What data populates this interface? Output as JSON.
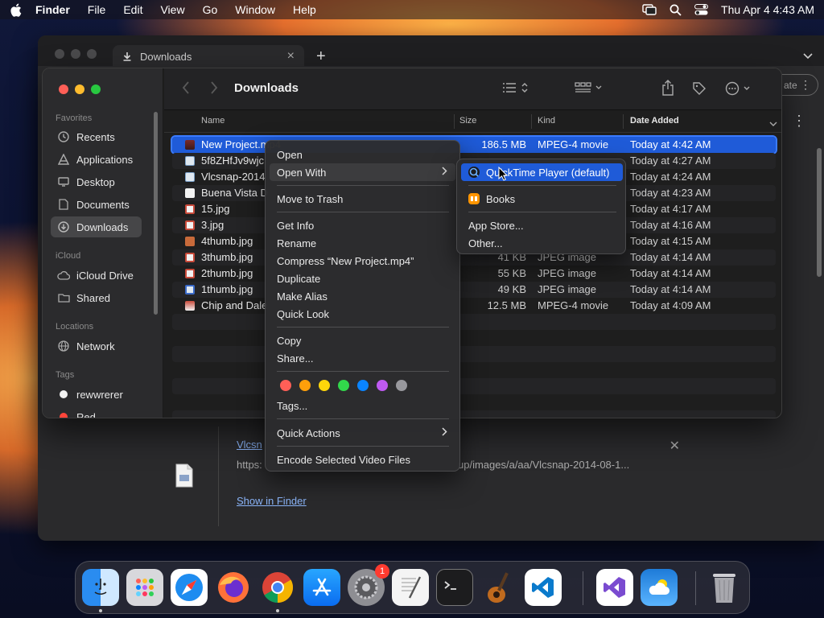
{
  "menubar": {
    "app_name": "Finder",
    "menus": [
      "File",
      "Edit",
      "View",
      "Go",
      "Window",
      "Help"
    ],
    "clock": "Thu Apr 4  4:43 AM"
  },
  "browser": {
    "tab_title": "Downloads",
    "side_pill_label": "ate",
    "download": {
      "file_link": "Vlcsn",
      "url_start": "https:",
      "url_end": "up/images/a/aa/Vlcsnap-2014-08-1...",
      "show_in_finder": "Show in Finder"
    }
  },
  "finder": {
    "title": "Downloads",
    "sidebar": {
      "favorites_label": "Favorites",
      "favorites": [
        "Recents",
        "Applications",
        "Desktop",
        "Documents",
        "Downloads"
      ],
      "icloud_label": "iCloud",
      "icloud": [
        "iCloud Drive",
        "Shared"
      ],
      "locations_label": "Locations",
      "locations": [
        "Network"
      ],
      "tags_label": "Tags",
      "tags": [
        "rewwrerer",
        "Red"
      ]
    },
    "columns": {
      "name": "Name",
      "size": "Size",
      "kind": "Kind",
      "date": "Date Added"
    },
    "files": [
      {
        "name": "New Project.mp4",
        "size": "186.5 MB",
        "kind": "MPEG-4 movie",
        "date": "Today at 4:42 AM"
      },
      {
        "name": "5f8ZHfJv9wjc",
        "size": "",
        "kind": "",
        "date": "Today at 4:27 AM"
      },
      {
        "name": "Vlcsnap-2014",
        "size": "",
        "kind": "",
        "date": "Today at 4:24 AM"
      },
      {
        "name": "Buena Vista D",
        "size": "",
        "kind": "",
        "date": "Today at 4:23 AM"
      },
      {
        "name": "15.jpg",
        "size": "",
        "kind": "",
        "date": "Today at 4:17 AM"
      },
      {
        "name": "3.jpg",
        "size": "",
        "kind": "",
        "date": "Today at 4:16 AM"
      },
      {
        "name": "4thumb.jpg",
        "size": "",
        "kind": "",
        "date": "Today at 4:15 AM"
      },
      {
        "name": "3thumb.jpg",
        "size": "41 KB",
        "kind": "JPEG image",
        "date": "Today at 4:14 AM"
      },
      {
        "name": "2thumb.jpg",
        "size": "55 KB",
        "kind": "JPEG image",
        "date": "Today at 4:14 AM"
      },
      {
        "name": "1thumb.jpg",
        "size": "49 KB",
        "kind": "JPEG image",
        "date": "Today at 4:14 AM"
      },
      {
        "name": "Chip and Dale",
        "size": "12.5 MB",
        "kind": "MPEG-4 movie",
        "date": "Today at 4:09 AM"
      }
    ]
  },
  "context_menu": {
    "open": "Open",
    "open_with": "Open With",
    "move_to_trash": "Move to Trash",
    "get_info": "Get Info",
    "rename": "Rename",
    "compress": "Compress “New Project.mp4”",
    "duplicate": "Duplicate",
    "make_alias": "Make Alias",
    "quick_look": "Quick Look",
    "copy": "Copy",
    "share": "Share...",
    "tags": "Tags...",
    "quick_actions": "Quick Actions",
    "encode": "Encode Selected Video Files",
    "tag_colors": [
      "#ff5f57",
      "#ff9f0a",
      "#ffd60a",
      "#32d74b",
      "#0a84ff",
      "#bf5af2",
      "#98989d"
    ]
  },
  "submenu": {
    "quicktime": "QuickTime Player (default)",
    "books": "Books",
    "app_store": "App Store...",
    "other": "Other..."
  },
  "dock": {
    "settings_badge": "1",
    "apps": [
      "finder-icon",
      "launchpad-icon",
      "safari-icon",
      "firefox-icon",
      "chrome-icon",
      "app-store-icon",
      "system-settings-icon",
      "textedit-icon",
      "terminal-icon",
      "garageband-icon",
      "vscode-icon",
      "visual-studio-icon",
      "weather-icon",
      "trash-icon"
    ]
  },
  "colors": {
    "accent": "#1f5bd8",
    "selection_outline": "#3a7bff"
  }
}
